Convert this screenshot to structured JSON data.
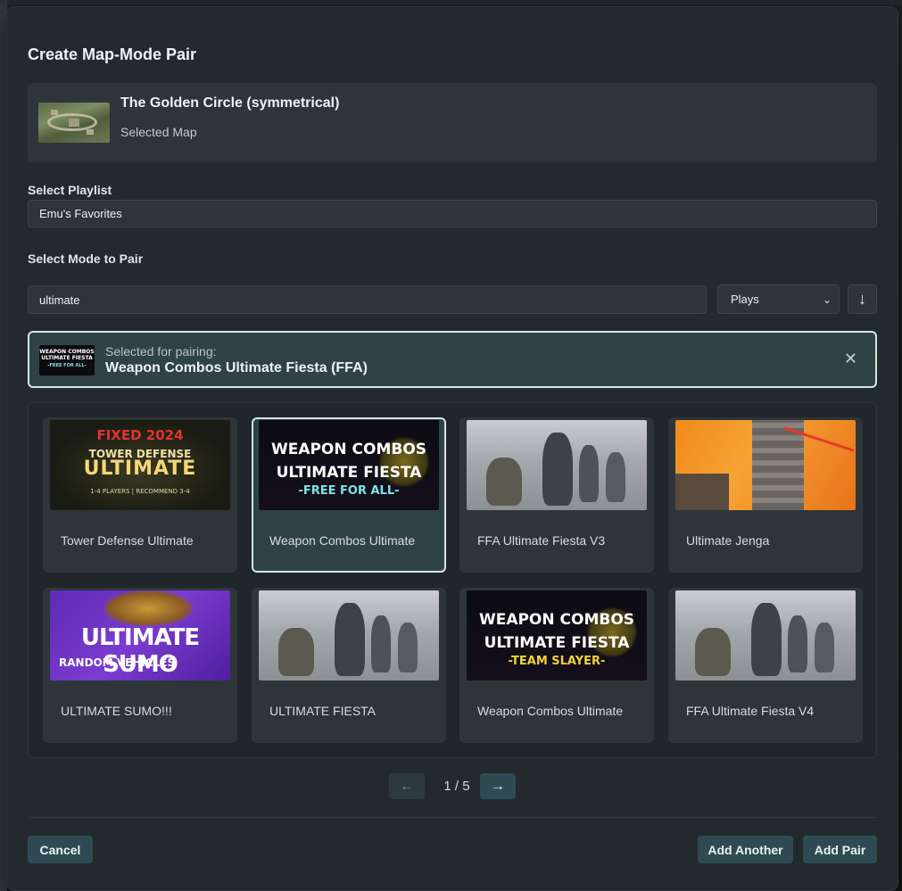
{
  "modal": {
    "title": "Create Map-Mode Pair",
    "cancel_label": "Cancel",
    "add_another_label": "Add Another",
    "add_pair_label": "Add Pair"
  },
  "map": {
    "name": "The Golden Circle (symmetrical)",
    "subtitle": "Selected Map"
  },
  "playlist": {
    "label": "Select Playlist",
    "value": "Emu's Favorites"
  },
  "mode": {
    "label": "Select Mode to Pair",
    "search_value": "ultimate",
    "sort_value": "Plays",
    "sort_icon": "arrow-down-icon"
  },
  "selected": {
    "label": "Selected for pairing:",
    "name": "Weapon Combos Ultimate Fiesta (FFA)"
  },
  "results": [
    {
      "name": "Tower Defense Ultimate",
      "thumb_text": [
        "FIXED 2024",
        "TOWER DEFENSE",
        "ULTIMATE",
        "1-4 PLAYERS | RECOMMEND 3-4"
      ]
    },
    {
      "name": "Weapon Combos Ultimate",
      "thumb_text": [
        "WEAPON COMBOS",
        "ULTIMATE FIESTA",
        "-FREE FOR ALL-"
      ]
    },
    {
      "name": "FFA Ultimate Fiesta V3"
    },
    {
      "name": "Ultimate Jenga"
    },
    {
      "name": "ULTIMATE SUMO!!!",
      "thumb_text": [
        "ULTIMATE SUMO",
        "RANDOM VEHICLES"
      ]
    },
    {
      "name": "ULTIMATE FIESTA"
    },
    {
      "name": "Weapon Combos Ultimate",
      "thumb_text": [
        "WEAPON COMBOS",
        "ULTIMATE FIESTA",
        "-TEAM SLAYER-"
      ]
    },
    {
      "name": "FFA Ultimate Fiesta V4"
    }
  ],
  "pager": {
    "text": "1 / 5",
    "prev_icon": "←",
    "next_icon": "→"
  },
  "close_icon": "✕",
  "colors": {
    "modal_bg": "#232a2d",
    "accent_button": "#2f4a52",
    "selected_border": "#d9e4e6"
  }
}
